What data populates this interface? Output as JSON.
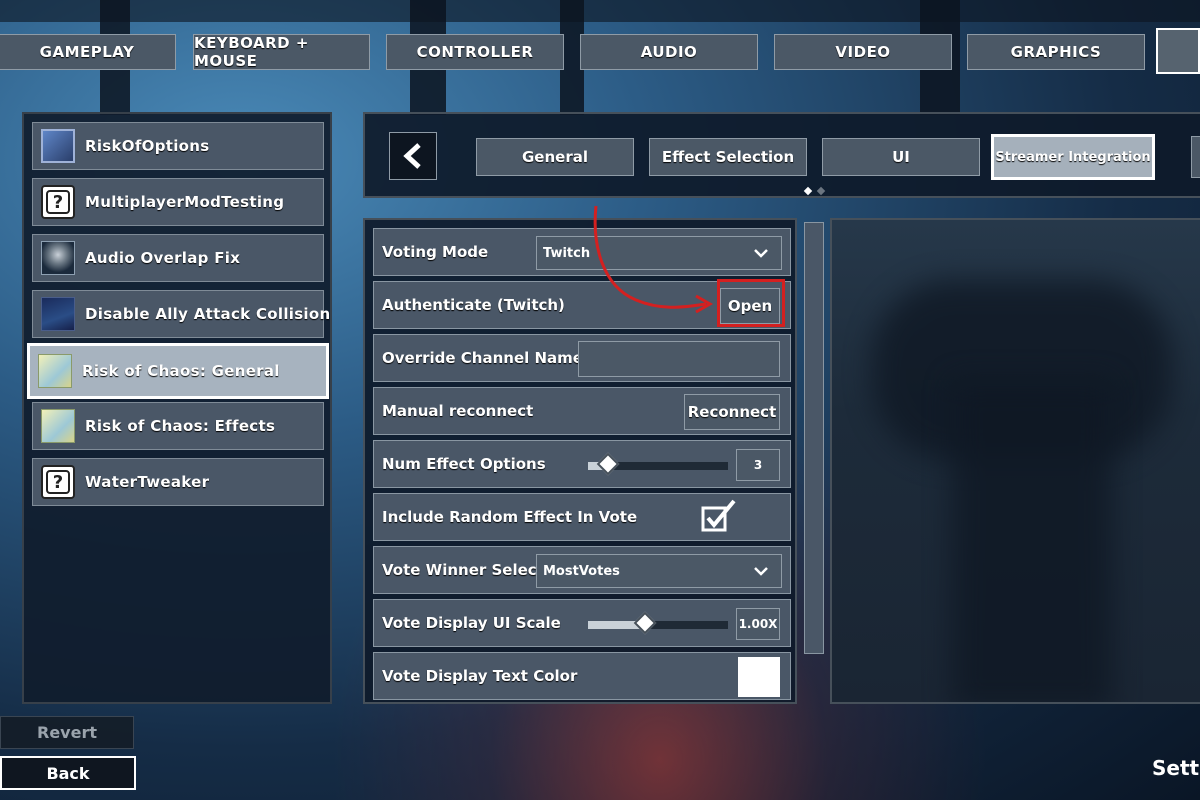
{
  "top_tabs": [
    "GAMEPLAY",
    "KEYBOARD + MOUSE",
    "CONTROLLER",
    "AUDIO",
    "VIDEO",
    "GRAPHICS"
  ],
  "mods": [
    {
      "label": "RiskOfOptions",
      "icon": "riskofoptions-icon"
    },
    {
      "label": "MultiplayerModTesting",
      "icon": "question-icon"
    },
    {
      "label": "Audio Overlap Fix",
      "icon": "audio-fix-icon"
    },
    {
      "label": "Disable Ally Attack Collision",
      "icon": "collision-icon"
    },
    {
      "label": "Risk of Chaos: General",
      "icon": "chaos-icon"
    },
    {
      "label": "Risk of Chaos: Effects",
      "icon": "chaos-icon"
    },
    {
      "label": "WaterTweaker",
      "icon": "question-icon"
    }
  ],
  "sub_tabs": {
    "back_icon": "chevron-left-icon",
    "items": [
      "General",
      "Effect Selection",
      "UI",
      "Streamer Integration"
    ],
    "selected": "Streamer Integration"
  },
  "settings": {
    "voting_mode": {
      "label": "Voting Mode",
      "value": "Twitch"
    },
    "authenticate": {
      "label": "Authenticate (Twitch)",
      "button": "Open"
    },
    "override_channel": {
      "label": "Override Channel Name",
      "value": ""
    },
    "manual_reconnect": {
      "label": "Manual reconnect",
      "button": "Reconnect"
    },
    "num_effect_options": {
      "label": "Num Effect Options",
      "value": "3",
      "slider_fraction": 0.14
    },
    "include_random": {
      "label": "Include Random Effect In Vote",
      "checked": true
    },
    "vote_winner": {
      "label": "Vote Winner Selectio",
      "value": "MostVotes"
    },
    "vote_display_scale": {
      "label": "Vote Display UI Scale",
      "value": "1.00X",
      "slider_fraction": 0.41
    },
    "vote_text_color": {
      "label": "Vote Display Text Color",
      "color": "#ffffff"
    }
  },
  "bottom": {
    "revert": "Revert",
    "back": "Back",
    "title": "Setti"
  },
  "colors": {
    "highlight": "#d42020",
    "panel": "#4a5767"
  }
}
